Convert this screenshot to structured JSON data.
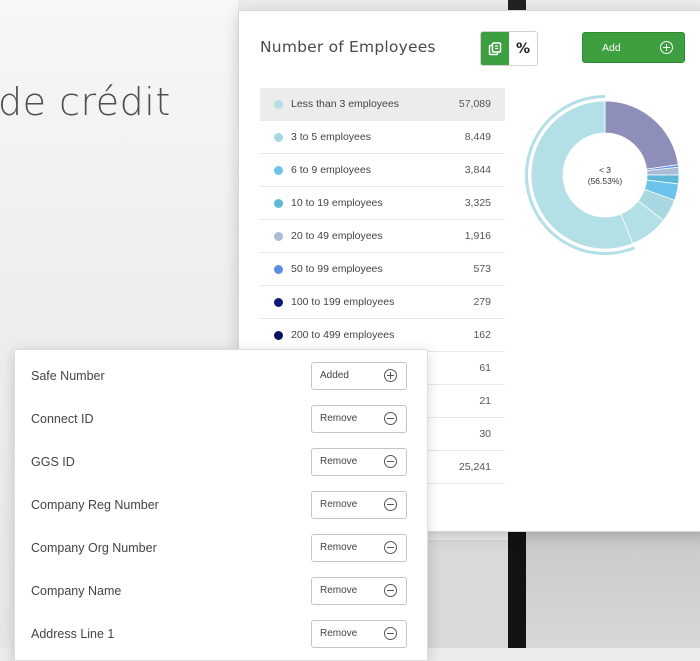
{
  "background": {
    "heading": "de crédit"
  },
  "employees": {
    "title": "Number of Employees",
    "toggle_percent_label": "%",
    "add_label": "Add",
    "rows": [
      {
        "label": "Less than 3 employees",
        "value": "57,089",
        "color": "#b3dfe6",
        "selected": true
      },
      {
        "label": "3 to 5 employees",
        "value": "8,449",
        "color": "#a8d7e2"
      },
      {
        "label": "6 to 9 employees",
        "value": "3,844",
        "color": "#6cc3ec"
      },
      {
        "label": "10 to 19 employees",
        "value": "3,325",
        "color": "#5fb8d8"
      },
      {
        "label": "20 to 49 employees",
        "value": "1,916",
        "color": "#a9bcd3"
      },
      {
        "label": "50 to 99 employees",
        "value": "573",
        "color": "#5b8ee6"
      },
      {
        "label": "100 to 199 employees",
        "value": "279",
        "color": "#0e1a78"
      },
      {
        "label": "200 to 499 employees",
        "value": "162",
        "color": "#05105e"
      },
      {
        "label": "",
        "value": "61",
        "color": ""
      },
      {
        "label": "",
        "value": "21",
        "color": ""
      },
      {
        "label": "",
        "value": "30",
        "color": ""
      },
      {
        "label": "",
        "value": "25,241",
        "color": ""
      }
    ],
    "donut": {
      "center_label": "< 3",
      "center_pct": "(56.53%)",
      "segment_colors": [
        "#8e8eba",
        "#b3dfe6",
        "#a8d7e2",
        "#6cc3ec",
        "#5fb8d8",
        "#a9bcd3",
        "#5b8ee6",
        "#0e1a78",
        "#05105e"
      ]
    }
  },
  "fields": [
    {
      "label": "Safe Number",
      "button": "Added",
      "icon": "plus-circle-icon"
    },
    {
      "label": "Connect ID",
      "button": "Remove",
      "icon": "minus-circle-icon"
    },
    {
      "label": "GGS ID",
      "button": "Remove",
      "icon": "minus-circle-icon"
    },
    {
      "label": "Company Reg Number",
      "button": "Remove",
      "icon": "minus-circle-icon"
    },
    {
      "label": "Company Org Number",
      "button": "Remove",
      "icon": "minus-circle-icon"
    },
    {
      "label": "Company Name",
      "button": "Remove",
      "icon": "minus-circle-icon"
    },
    {
      "label": "Address Line 1",
      "button": "Remove",
      "icon": "minus-circle-icon"
    }
  ]
}
